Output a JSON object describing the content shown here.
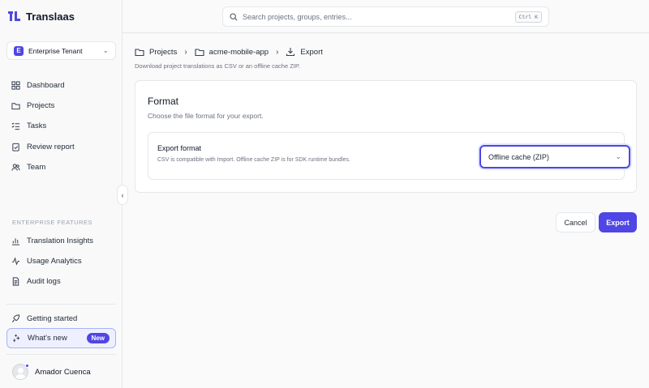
{
  "app": {
    "name": "Translaas"
  },
  "tenant": {
    "badge": "E",
    "name": "Enterprise Tenant"
  },
  "sidebar": {
    "nav": [
      {
        "label": "Dashboard",
        "icon": "grid-icon"
      },
      {
        "label": "Projects",
        "icon": "folder-icon"
      },
      {
        "label": "Tasks",
        "icon": "tasks-icon"
      },
      {
        "label": "Review report",
        "icon": "clipboard-check-icon"
      },
      {
        "label": "Team",
        "icon": "users-icon"
      }
    ],
    "enterprise_label": "ENTERPRISE FEATURES",
    "enterprise": [
      {
        "label": "Translation Insights",
        "icon": "bar-chart-icon"
      },
      {
        "label": "Usage Analytics",
        "icon": "activity-icon"
      },
      {
        "label": "Audit logs",
        "icon": "document-icon"
      }
    ],
    "getting_started": "Getting started",
    "whats_new": "What's new",
    "new_badge": "New",
    "user_name": "Amador Cuenca"
  },
  "search": {
    "placeholder": "Search projects, groups, entries...",
    "shortcut": "Ctrl K"
  },
  "breadcrumb": {
    "projects": "Projects",
    "project": "acme-mobile-app",
    "current": "Export"
  },
  "page": {
    "subtitle": "Download project translations as CSV or an offline cache ZIP."
  },
  "format": {
    "title": "Format",
    "description": "Choose the file format for your export.",
    "field_label": "Export format",
    "field_help": "CSV is compatible with Import. Offline cache ZIP is for SDK runtime bundles.",
    "selected": "Offline cache (ZIP)"
  },
  "actions": {
    "cancel": "Cancel",
    "export": "Export"
  },
  "colors": {
    "accent": "#4f46e5",
    "accent_light": "#eef0ff"
  }
}
